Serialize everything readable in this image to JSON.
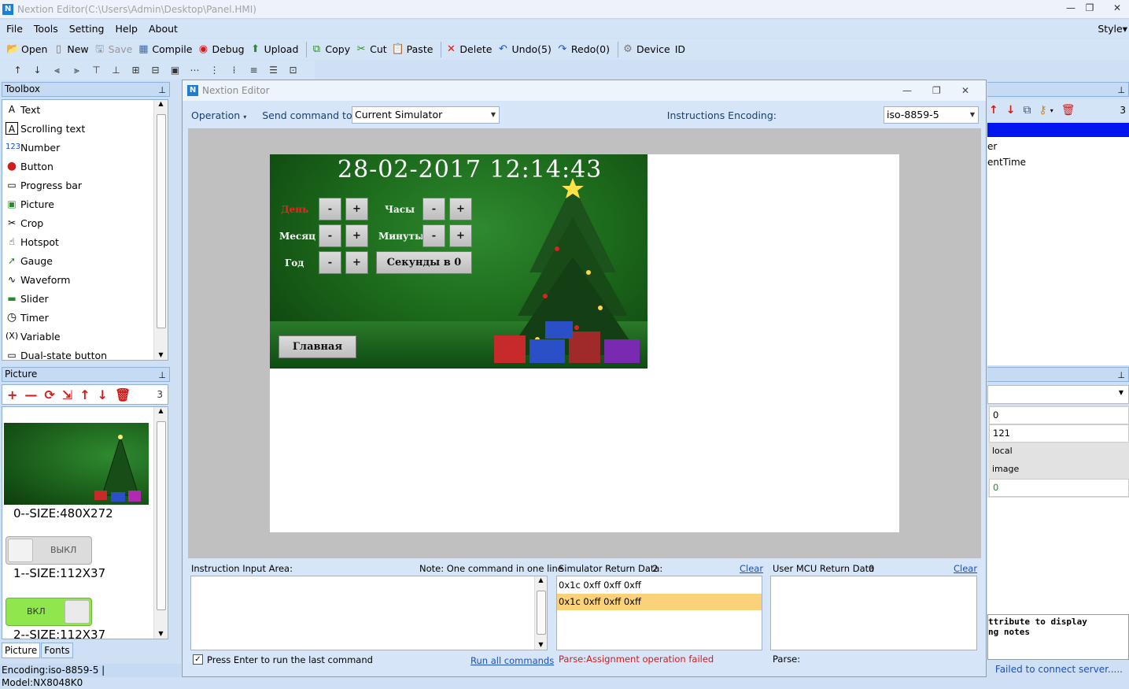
{
  "app": {
    "title": "Nextion Editor(C:\\Users\\Admin\\Desktop\\Panel.HMI)",
    "style_label": "Style"
  },
  "menu": [
    "File",
    "Tools",
    "Setting",
    "Help",
    "About"
  ],
  "toolbar": {
    "open": "Open",
    "new": "New",
    "save": "Save",
    "compile": "Compile",
    "debug": "Debug",
    "upload": "Upload",
    "copy": "Copy",
    "cut": "Cut",
    "paste": "Paste",
    "delete": "Delete",
    "undo": "Undo(5)",
    "redo": "Redo(0)",
    "device": "Device",
    "id": "ID"
  },
  "toolbox": {
    "title": "Toolbox",
    "items": [
      "Text",
      "Scrolling text",
      "Number",
      "Button",
      "Progress bar",
      "Picture",
      "Crop",
      "Hotspot",
      "Gauge",
      "Waveform",
      "Slider",
      "Timer",
      "Variable",
      "Dual-state button"
    ],
    "icons": [
      "A",
      "A",
      "123",
      "●",
      "▭",
      "▣",
      "✂",
      "☝",
      "➚",
      "∿",
      "▬",
      "◷",
      "(X)",
      "▭"
    ]
  },
  "picture_panel": {
    "title": "Picture",
    "count": "3",
    "items": [
      {
        "label": "0--SIZE:480X272"
      },
      {
        "label": "1--SIZE:112X37",
        "btn_text": "ВЫКЛ"
      },
      {
        "label": "2--SIZE:112X37",
        "btn_text": "ВКЛ"
      }
    ],
    "tabs": [
      "Picture",
      "Fonts"
    ]
  },
  "status": {
    "left": "Encoding:iso-8859-5 | Model:NX8048K0",
    "right": "Failed to connect server....."
  },
  "editor": {
    "title": "Nextion Editor",
    "operation": "Operation",
    "send_label": "Send command to:",
    "send_value": "Current Simulator",
    "enc_label": "Instructions Encoding:",
    "enc_value": "iso-8859-5"
  },
  "hmi": {
    "datetime": "28-02-2017  12:14:43",
    "day": "День",
    "month": "Месяц",
    "year": "Год",
    "hours": "Часы",
    "minutes": "Минуты",
    "seconds_btn": "Секунды в 0",
    "main_btn": "Главная",
    "minus": "-",
    "plus": "+"
  },
  "input_area": {
    "title": "Instruction Input Area:",
    "note": "Note: One command in one line",
    "checkbox": "Press Enter to run the last command",
    "run_all": "Run all commands"
  },
  "sim_return": {
    "title": "Simulator Return Data:",
    "count": "2",
    "clear": "Clear",
    "rows": [
      "0x1c 0xff 0xff 0xff",
      "0x1c 0xff 0xff 0xff"
    ],
    "parse": "Parse:Assignment operation failed"
  },
  "mcu_return": {
    "title": "User MCU Return Data",
    "count": "0",
    "clear": "Clear",
    "parse": "Parse:"
  },
  "right": {
    "count": "3",
    "line1": "er",
    "line2": "entTime",
    "props": [
      "0",
      "121",
      "local",
      "image",
      "0"
    ],
    "note1": "ttribute to display",
    "note2": "ng notes"
  },
  "colors": {
    "accent": "#1a4fc7",
    "error": "#d21b1b",
    "highlight": "#fbd27a"
  }
}
